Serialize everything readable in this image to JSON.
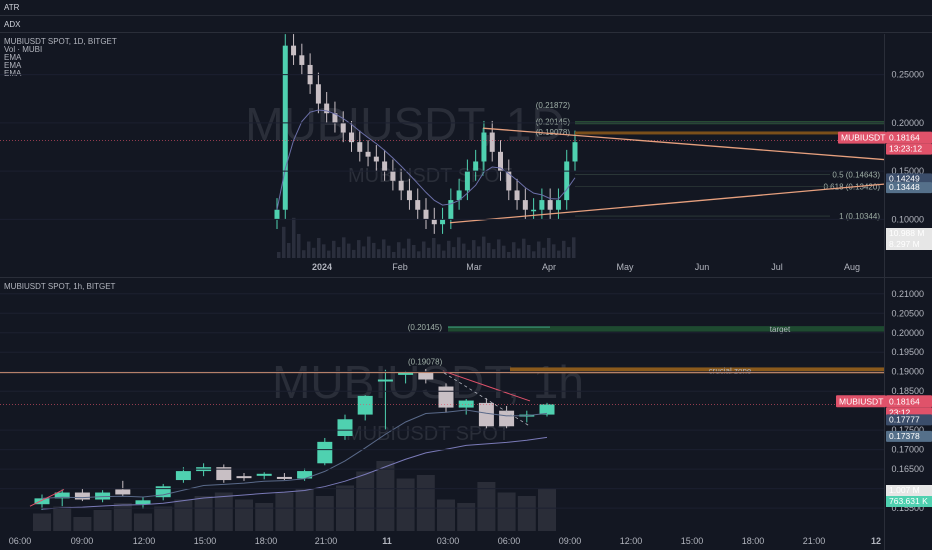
{
  "panes": {
    "atr": "ATR",
    "adx": "ADX"
  },
  "daily": {
    "legend": [
      "MUBIUSDT SPOT, 1D, BITGET",
      "Vol · MUBI",
      "EMA",
      "EMA",
      "EMA"
    ],
    "watermark": "MUBIUSDT, 1D",
    "watermark_sub": "MUBIUSDT SPOT",
    "x_labels": [
      "2024",
      "Feb",
      "Mar",
      "Apr",
      "May",
      "Jun",
      "Jul",
      "Aug"
    ],
    "y_labels": [
      "0.25000",
      "0.20000",
      "0.15000",
      "0.10000"
    ],
    "fib_labels": [
      "(0.21872)",
      "(0.20145)",
      "(0.19078)",
      "0.5 (0.14643)",
      "0.618 (0.13420)",
      "1 (0.10344)"
    ],
    "badges": {
      "symbol": "MUBIUSDT",
      "price": "0.18164",
      "countdown": "13:23:12",
      "ema1": "0.14249",
      "ema2": "0.13448",
      "vol1": "10.988 M",
      "vol2": "8.297 M"
    }
  },
  "hourly": {
    "legend": [
      "MUBIUSDT SPOT, 1h, BITGET"
    ],
    "watermark": "MUBIUSDT, 1h",
    "watermark_sub": "MUBIUSDT SPOT",
    "x_labels": [
      "06:00",
      "09:00",
      "12:00",
      "15:00",
      "18:00",
      "21:00",
      "11",
      "03:00",
      "06:00",
      "09:00",
      "12:00",
      "15:00",
      "18:00",
      "21:00",
      "12"
    ],
    "y_labels": [
      "0.21000",
      "0.20500",
      "0.20000",
      "0.19500",
      "0.19000",
      "0.18500",
      "0.17500",
      "0.17000",
      "0.16500",
      "0.16000",
      "0.15500"
    ],
    "zones": {
      "target": "target",
      "crucial": "crucial zone"
    },
    "zone_labels": [
      "(0.20145)",
      "(0.19078)"
    ],
    "badges": {
      "symbol": "MUBIUSDT",
      "price": "0.18164",
      "countdown": "23:12",
      "ema1": "0.17777",
      "ema2": "0.17378",
      "vol1": "1.007 M",
      "vol2": "763.631 K"
    }
  },
  "colors": {
    "up": "#4fd1b0",
    "down": "#c8bfc4",
    "price_badge": "#e0526a",
    "ema_badge1": "#3b4d6a",
    "ema_badge2": "#55708a",
    "trendline": "#e7a07e",
    "target_zone": "#1e4a30",
    "crucial_zone": "#8a5a1c"
  },
  "chart_data": [
    {
      "type": "candlestick",
      "title": "MUBIUSDT SPOT, 1D, BITGET",
      "x_ticks": [
        "2024",
        "Feb",
        "Mar",
        "Apr",
        "May",
        "Jun",
        "Jul",
        "Aug"
      ],
      "y_ticks": [
        0.25,
        0.2,
        0.15,
        0.1
      ],
      "ylim": [
        0.06,
        0.29
      ],
      "last_price": 0.18164,
      "ema_values": [
        0.14249,
        0.13448
      ],
      "volume_values_m": [
        10.988,
        8.297
      ],
      "fib_levels": [
        {
          "ratio": null,
          "value": 0.21872
        },
        {
          "ratio": null,
          "value": 0.20145
        },
        {
          "ratio": null,
          "value": 0.19078
        },
        {
          "ratio": 0.5,
          "value": 0.14643
        },
        {
          "ratio": 0.618,
          "value": 0.1342
        },
        {
          "ratio": 1,
          "value": 0.10344
        }
      ],
      "closes_approx": [
        0.11,
        0.28,
        0.27,
        0.26,
        0.24,
        0.22,
        0.21,
        0.2,
        0.19,
        0.18,
        0.17,
        0.165,
        0.16,
        0.15,
        0.14,
        0.13,
        0.12,
        0.11,
        0.1,
        0.095,
        0.1,
        0.12,
        0.13,
        0.15,
        0.16,
        0.19,
        0.17,
        0.15,
        0.13,
        0.12,
        0.11,
        0.11,
        0.12,
        0.11,
        0.12,
        0.16,
        0.18
      ]
    },
    {
      "type": "candlestick",
      "title": "MUBIUSDT SPOT, 1h, BITGET",
      "x_ticks": [
        "06:00",
        "09:00",
        "12:00",
        "15:00",
        "18:00",
        "21:00",
        "11",
        "03:00",
        "06:00",
        "09:00",
        "12:00",
        "15:00",
        "18:00",
        "21:00",
        "12"
      ],
      "y_ticks": [
        0.21,
        0.205,
        0.2,
        0.195,
        0.19,
        0.185,
        0.175,
        0.17,
        0.165,
        0.16,
        0.155
      ],
      "ylim": [
        0.154,
        0.212
      ],
      "last_price": 0.18164,
      "ema_values": [
        0.17777,
        0.17378
      ],
      "zones": [
        {
          "label": "target",
          "from": 0.2003,
          "to": 0.2017
        },
        {
          "label": "crucial zone",
          "from": 0.1896,
          "to": 0.1911
        }
      ],
      "candles": [
        {
          "o": 0.156,
          "h": 0.1585,
          "l": 0.1545,
          "c": 0.1575
        },
        {
          "o": 0.1575,
          "h": 0.1598,
          "l": 0.1555,
          "c": 0.159
        },
        {
          "o": 0.159,
          "h": 0.16,
          "l": 0.1568,
          "c": 0.1572
        },
        {
          "o": 0.1572,
          "h": 0.1596,
          "l": 0.1565,
          "c": 0.159
        },
        {
          "o": 0.1598,
          "h": 0.162,
          "l": 0.158,
          "c": 0.1585
        },
        {
          "o": 0.156,
          "h": 0.1578,
          "l": 0.1548,
          "c": 0.157
        },
        {
          "o": 0.1578,
          "h": 0.1612,
          "l": 0.157,
          "c": 0.1606
        },
        {
          "o": 0.1622,
          "h": 0.1655,
          "l": 0.1615,
          "c": 0.1645
        },
        {
          "o": 0.1645,
          "h": 0.1665,
          "l": 0.1632,
          "c": 0.1655
        },
        {
          "o": 0.1655,
          "h": 0.1662,
          "l": 0.1615,
          "c": 0.1622
        },
        {
          "o": 0.1632,
          "h": 0.164,
          "l": 0.162,
          "c": 0.1628
        },
        {
          "o": 0.1634,
          "h": 0.1642,
          "l": 0.1624,
          "c": 0.1638
        },
        {
          "o": 0.163,
          "h": 0.164,
          "l": 0.1622,
          "c": 0.1626
        },
        {
          "o": 0.1626,
          "h": 0.1652,
          "l": 0.162,
          "c": 0.1645
        },
        {
          "o": 0.1665,
          "h": 0.173,
          "l": 0.166,
          "c": 0.172
        },
        {
          "o": 0.1735,
          "h": 0.179,
          "l": 0.1725,
          "c": 0.1778
        },
        {
          "o": 0.179,
          "h": 0.184,
          "l": 0.1775,
          "c": 0.1838
        },
        {
          "o": 0.1878,
          "h": 0.1905,
          "l": 0.1752,
          "c": 0.188
        },
        {
          "o": 0.1892,
          "h": 0.1902,
          "l": 0.187,
          "c": 0.1897
        },
        {
          "o": 0.1897,
          "h": 0.1907,
          "l": 0.187,
          "c": 0.188
        },
        {
          "o": 0.1862,
          "h": 0.187,
          "l": 0.1795,
          "c": 0.1808
        },
        {
          "o": 0.1808,
          "h": 0.183,
          "l": 0.179,
          "c": 0.1826
        },
        {
          "o": 0.182,
          "h": 0.1832,
          "l": 0.1755,
          "c": 0.176
        },
        {
          "o": 0.18,
          "h": 0.1812,
          "l": 0.1755,
          "c": 0.176
        },
        {
          "o": 0.179,
          "h": 0.18,
          "l": 0.177,
          "c": 0.179
        },
        {
          "o": 0.179,
          "h": 0.182,
          "l": 0.1785,
          "c": 0.1816
        }
      ],
      "volume_levels_relative": [
        0.25,
        0.35,
        0.2,
        0.3,
        0.4,
        0.25,
        0.35,
        0.45,
        0.5,
        0.55,
        0.45,
        0.4,
        0.55,
        0.6,
        0.5,
        0.65,
        0.85,
        1.0,
        0.75,
        0.8,
        0.45,
        0.4,
        0.7,
        0.55,
        0.5,
        0.6
      ]
    }
  ]
}
